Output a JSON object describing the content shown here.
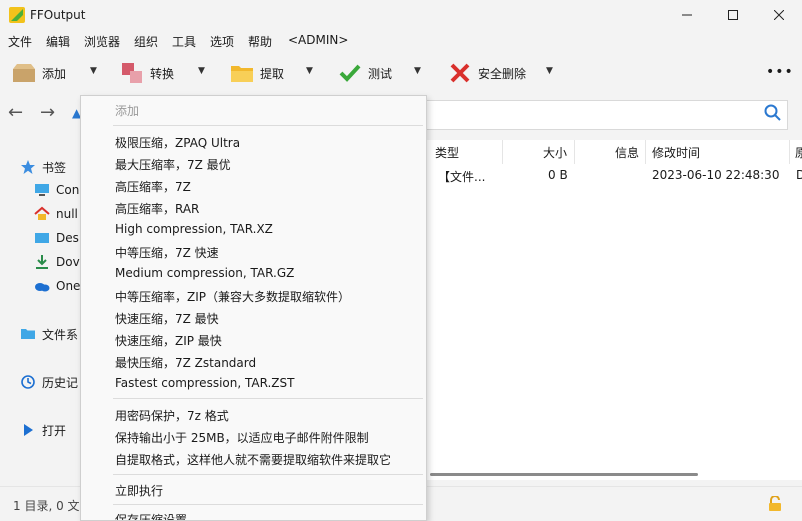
{
  "window": {
    "title": "FFOutput"
  },
  "menu": [
    "文件",
    "编辑",
    "浏览器",
    "组织",
    "工具",
    "选项",
    "帮助",
    "<ADMIN>"
  ],
  "toolbar": {
    "add": "添加",
    "convert": "转换",
    "extract": "提取",
    "test": "测试",
    "secure_delete": "安全删除"
  },
  "sidebar": {
    "bookmarks": "书签",
    "items": [
      "Con",
      "null",
      "Des",
      "Dov",
      "One"
    ],
    "filesystem": "文件系",
    "history": "历史记",
    "open": "打开"
  },
  "file_list": {
    "columns": [
      "类型",
      "大小",
      "信息",
      "修改时间",
      "原"
    ],
    "rows": [
      {
        "type": "【文件...",
        "size": "0 B",
        "info": "",
        "modified": "2023-06-10 22:48:30",
        "extra": "D"
      }
    ]
  },
  "status": {
    "text": "1 目录, 0 文"
  },
  "dropdown": {
    "header": "添加",
    "group1": [
      "极限压缩，ZPAQ Ultra",
      "最大压缩率，7Z 最优",
      "高压缩率，7Z",
      "高压缩率，RAR",
      "High compression, TAR.XZ",
      "中等压缩，7Z 快速",
      "Medium compression, TAR.GZ",
      "中等压缩率，ZIP（兼容大多数提取缩软件）",
      "快速压缩，7Z 最快",
      "快速压缩，ZIP 最快",
      "最快压缩，7Z Zstandard",
      "Fastest compression, TAR.ZST"
    ],
    "group2": [
      "用密码保护，7z 格式",
      "保持输出小于 25MB，以适应电子邮件附件限制",
      "自提取格式，这样他人就不需要提取缩软件来提取它"
    ],
    "run_now": "立即执行",
    "save_settings": "保存压缩设置"
  }
}
